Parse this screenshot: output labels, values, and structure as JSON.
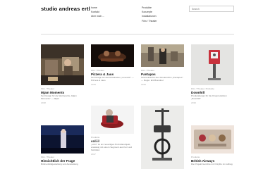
{
  "site": {
    "title": "studio andreas ertl"
  },
  "nav_left": [
    "home",
    "Kontakt",
    "über mich ..."
  ],
  "nav_right": [
    "Produkte",
    "Konzepte",
    "Installationen",
    "Film / Theater"
  ],
  "search": {
    "placeholder": "Search"
  },
  "cards": [
    {
      "meta": "Film / Theater",
      "title": "Mjam Moments",
      "desc": "Set Design für die Werbereihe „Mjam Moments\" — Mjam",
      "year": "2018"
    },
    {
      "meta": "Film / Theater",
      "title": "Pizzera & Jaus",
      "desc": "Set Design für das Musikvideo „Lovesick\" — Pizzera & Jaus",
      "year": "2019"
    },
    {
      "meta": "Film / Theater",
      "title": "Pantapos",
      "desc": "Szenenbild für den Kinokurzfilm „Pantapos\" — Regie: Ertl Brandner",
      "year": "2019"
    },
    {
      "meta": "Film / Theater, Produkte",
      "title": "Downhill",
      "desc": "Produktdesign für die Kinoproduktion „Downhill\"",
      "year": "2019"
    },
    {
      "meta": "Film / Theater",
      "title": "Hinsichtlich der Frage",
      "desc": "Bühnenbildgestaltung und Ausstattung",
      "year": ""
    },
    {
      "meta": "Produkte",
      "title": "coli il",
      "desc": "„coli il\" ist ein neuartiges Porzellanobjekt, ansässig mit einem Segment aus Kurt und Sichtfeld.",
      "year": "2017"
    },
    {
      "meta": "",
      "title": "",
      "desc": "",
      "year": ""
    },
    {
      "meta": "Produkte",
      "title": "British Airways",
      "desc": "Die Projekt Gerichte mit OnlyDo im Auftrag",
      "year": ""
    }
  ],
  "colors": {
    "accent_red": "#c8323c",
    "text": "#111111",
    "muted": "#999999"
  },
  "icons": [
    "search-icon"
  ]
}
